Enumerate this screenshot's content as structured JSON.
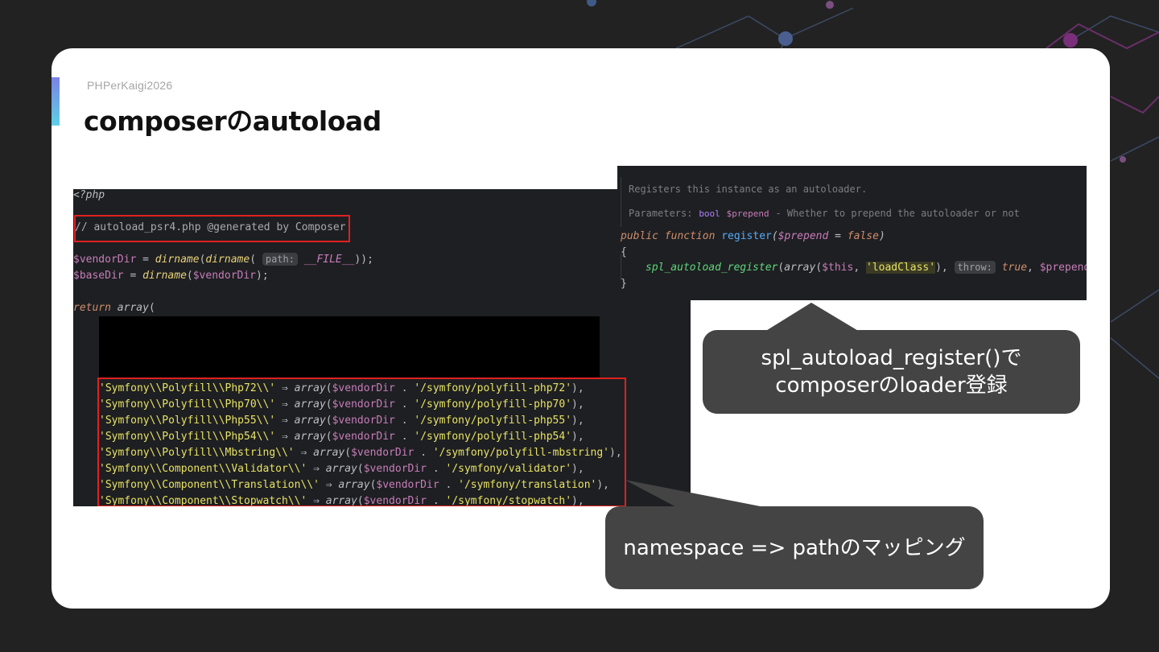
{
  "slide": {
    "eyebrow": "PHPerKaigi2026",
    "title": "composerのautoload"
  },
  "left_code": {
    "line1": "<?php",
    "line2": "// autoload_psr4.php @generated by Composer",
    "line3_a": "$vendorDir",
    "line3_b": " = ",
    "line3_c": "dirname",
    "line3_d": "(",
    "line3_e": "dirname",
    "line3_f": "( ",
    "line3_hint": "path:",
    "line3_g": " __FILE__",
    "line3_h": "));",
    "line4_a": "$baseDir",
    "line4_b": " = ",
    "line4_c": "dirname",
    "line4_d": "(",
    "line4_e": "$vendorDir",
    "line4_f": ");",
    "line5_a": "return ",
    "line5_b": "array",
    "line5_c": "(",
    "mappings": [
      {
        "ns": "'Symfony\\\\Polyfill\\\\Php72\\\\'",
        "path": "'/symfony/polyfill-php72'"
      },
      {
        "ns": "'Symfony\\\\Polyfill\\\\Php70\\\\'",
        "path": "'/symfony/polyfill-php70'"
      },
      {
        "ns": "'Symfony\\\\Polyfill\\\\Php55\\\\'",
        "path": "'/symfony/polyfill-php55'"
      },
      {
        "ns": "'Symfony\\\\Polyfill\\\\Php54\\\\'",
        "path": "'/symfony/polyfill-php54'"
      },
      {
        "ns": "'Symfony\\\\Polyfill\\\\Mbstring\\\\'",
        "path": "'/symfony/polyfill-mbstring'"
      },
      {
        "ns": "'Symfony\\\\Component\\\\Validator\\\\'",
        "path": "'/symfony/validator'"
      },
      {
        "ns": "'Symfony\\\\Component\\\\Translation\\\\'",
        "path": "'/symfony/translation'"
      },
      {
        "ns": "'Symfony\\\\Component\\\\Stopwatch\\\\'",
        "path": "'/symfony/stopwatch'"
      }
    ],
    "arrow": " ⇒ ",
    "array_kw": "array",
    "vendor_var": "$vendorDir",
    "dot": " . "
  },
  "right_code": {
    "doc1": "Registers this instance as an autoloader.",
    "doc2_label": "Parameters:",
    "doc2_type": "bool",
    "doc2_param": "$prepend",
    "doc2_desc": "- Whether to prepend the autoloader or not",
    "sig_a": "public function ",
    "sig_b": "register",
    "sig_c": "(",
    "sig_d": "$prepend",
    "sig_e": " = ",
    "sig_f": "false",
    "sig_g": ")",
    "brace_open": "{",
    "body_a": "spl_autoload_register",
    "body_b": "(",
    "body_c": "array",
    "body_d": "(",
    "body_e": "$this",
    "body_f": ", ",
    "body_g": "'loadClass'",
    "body_h": "), ",
    "body_hint": "throw:",
    "body_i": " true",
    "body_j": ", ",
    "body_k": "$prepend",
    "body_l": ");",
    "brace_close": "}"
  },
  "callouts": {
    "top_line1": "spl_autoload_register()で",
    "top_line2": "composerのloader登録",
    "bottom": "namespace => pathのマッピング"
  },
  "colors": {
    "background": "#222222",
    "card": "#ffffff",
    "callout": "#444444",
    "highlight_box": "#e02020",
    "code_bg": "#1e1f22"
  }
}
